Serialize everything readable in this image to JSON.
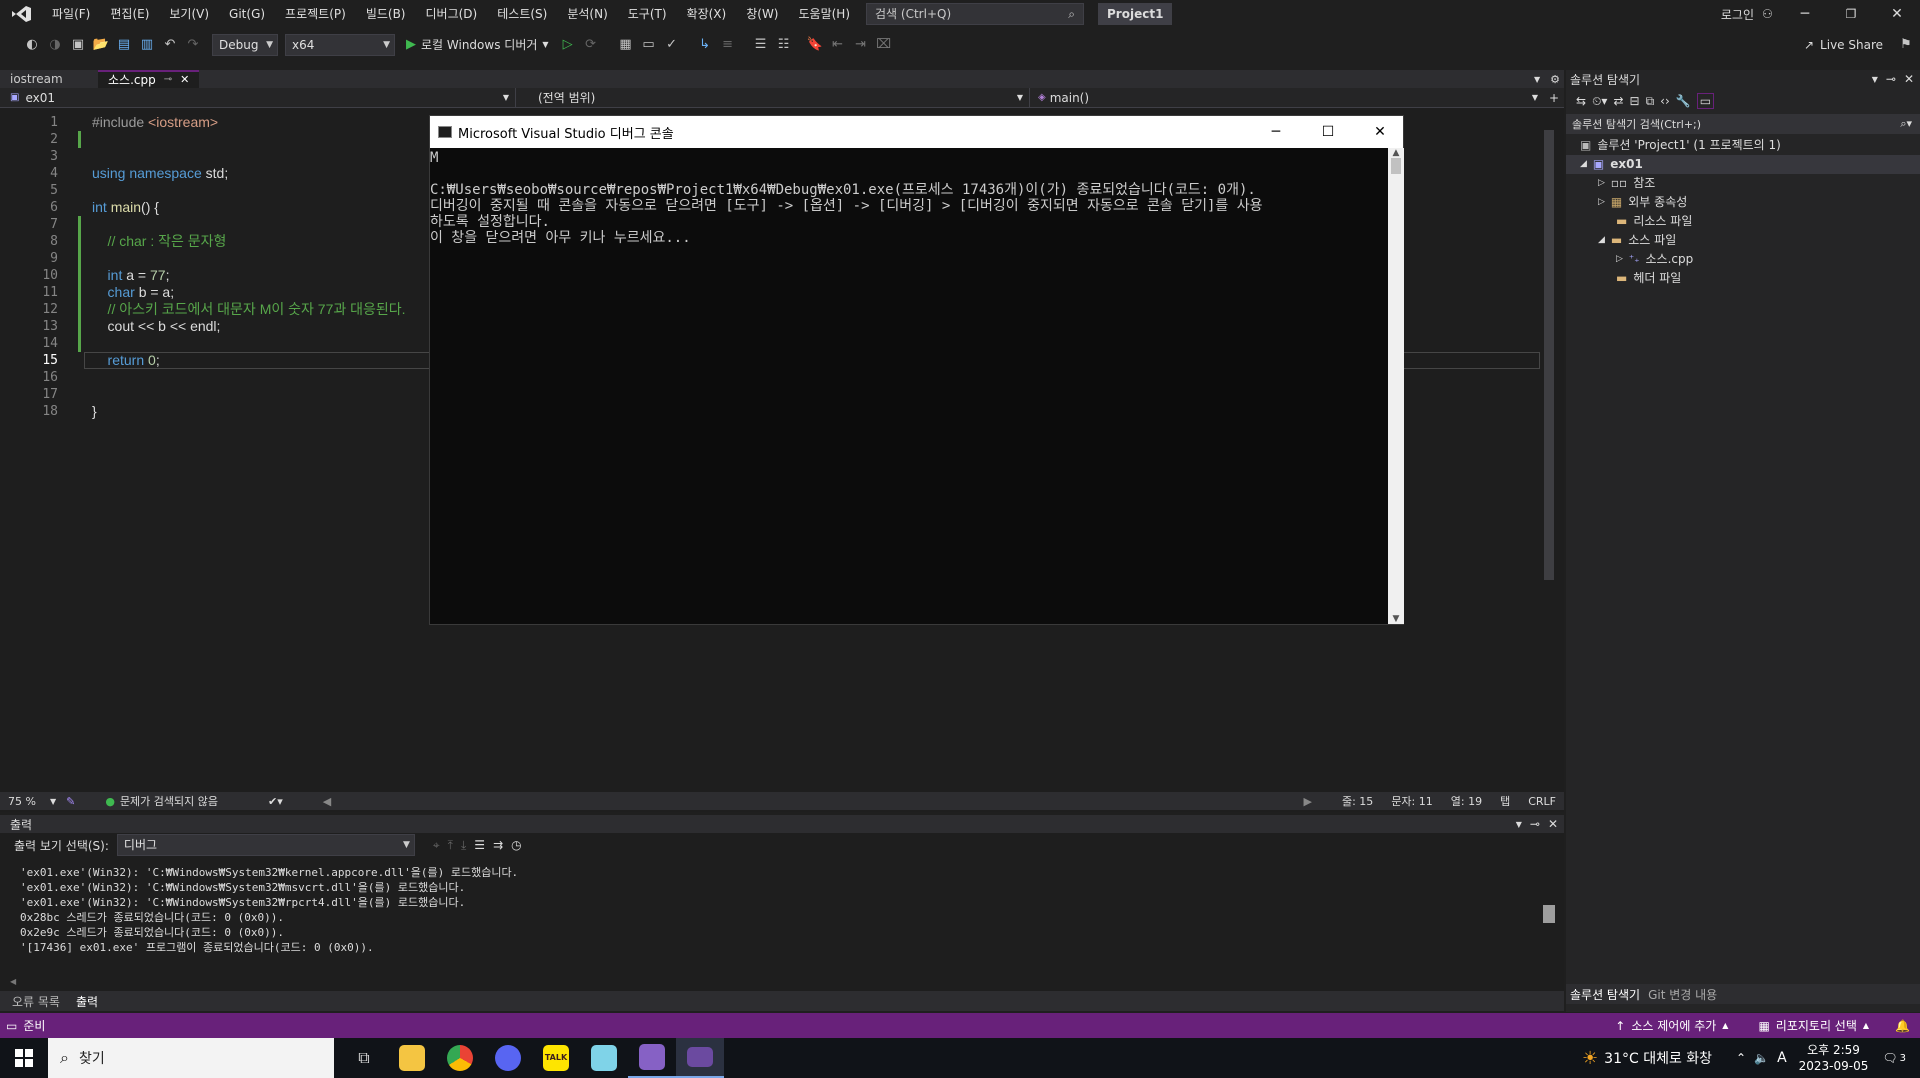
{
  "menu": [
    "파일(F)",
    "편집(E)",
    "보기(V)",
    "Git(G)",
    "프로젝트(P)",
    "빌드(B)",
    "디버그(D)",
    "테스트(S)",
    "분석(N)",
    "도구(T)",
    "확장(X)",
    "창(W)",
    "도움말(H)"
  ],
  "search_placeholder": "검색 (Ctrl+Q)",
  "project_name": "Project1",
  "login": "로그인",
  "live_share": "Live Share",
  "toolbar": {
    "config": "Debug",
    "platform": "x64",
    "run_label": "로컬 Windows 디버거"
  },
  "tabs": [
    "iostream",
    "소스.cpp"
  ],
  "nav": {
    "project": "ex01",
    "scope": "(전역 범위)",
    "member": "main()"
  },
  "code_lines": [
    {
      "n": "1",
      "segments": [
        {
          "c": "pp",
          "t": "#include "
        },
        {
          "c": "str",
          "t": "<iostream>"
        }
      ]
    },
    {
      "n": "2",
      "segments": []
    },
    {
      "n": "3",
      "segments": []
    },
    {
      "n": "4",
      "segments": [
        {
          "c": "kw",
          "t": "using namespace "
        },
        {
          "c": "id",
          "t": "std;"
        }
      ]
    },
    {
      "n": "5",
      "segments": []
    },
    {
      "n": "6",
      "segments": [
        {
          "c": "ty",
          "t": "int "
        },
        {
          "c": "fn",
          "t": "main"
        },
        {
          "c": "id",
          "t": "() {"
        }
      ]
    },
    {
      "n": "7",
      "segments": []
    },
    {
      "n": "8",
      "segments": [
        {
          "c": "cm",
          "t": "    // char : 작은 문자형"
        }
      ]
    },
    {
      "n": "9",
      "segments": []
    },
    {
      "n": "10",
      "segments": [
        {
          "c": "ty",
          "t": "    int "
        },
        {
          "c": "id",
          "t": "a = "
        },
        {
          "c": "num",
          "t": "77"
        },
        {
          "c": "id",
          "t": ";"
        }
      ]
    },
    {
      "n": "11",
      "segments": [
        {
          "c": "ty",
          "t": "    char "
        },
        {
          "c": "id",
          "t": "b = a;"
        }
      ]
    },
    {
      "n": "12",
      "segments": [
        {
          "c": "cm",
          "t": "    // 아스키 코드에서 대문자 M이 숫자 77과 대응된다."
        }
      ]
    },
    {
      "n": "13",
      "segments": [
        {
          "c": "id",
          "t": "    cout << b << endl;"
        }
      ]
    },
    {
      "n": "14",
      "segments": []
    },
    {
      "n": "15",
      "segments": [
        {
          "c": "kw",
          "t": "    return "
        },
        {
          "c": "num",
          "t": "0"
        },
        {
          "c": "id",
          "t": ";"
        }
      ]
    },
    {
      "n": "16",
      "segments": []
    },
    {
      "n": "17",
      "segments": []
    },
    {
      "n": "18",
      "segments": [
        {
          "c": "id",
          "t": "}"
        }
      ]
    }
  ],
  "console": {
    "title": "Microsoft Visual Studio 디버그 콘솔",
    "lines": [
      "M",
      "",
      "C:₩Users₩seobo₩source₩repos₩Project1₩x64₩Debug₩ex01.exe(프로세스 17436개)이(가) 종료되었습니다(코드: 0개).",
      "디버깅이 중지될 때 콘솔을 자동으로 닫으려면 [도구] -> [옵션] -> [디버깅] > [디버깅이 중지되면 자동으로 콘솔 닫기]를 사용",
      "하도록 설정합니다.",
      "이 창을 닫으려면 아무 키나 누르세요..."
    ]
  },
  "editor_status": {
    "zoom": "75 %",
    "issues": "문제가 검색되지 않음",
    "line": "줄: 15",
    "char": "문자: 11",
    "col": "열: 19",
    "tab": "탭",
    "eol": "CRLF"
  },
  "output": {
    "title": "출력",
    "select_label": "출력 보기 선택(S):",
    "select_value": "디버그",
    "lines": [
      "'ex01.exe'(Win32): 'C:₩Windows₩System32₩kernel.appcore.dll'을(를) 로드했습니다.",
      "'ex01.exe'(Win32): 'C:₩Windows₩System32₩msvcrt.dll'을(를) 로드했습니다.",
      "'ex01.exe'(Win32): 'C:₩Windows₩System32₩rpcrt4.dll'을(를) 로드했습니다.",
      "0x28bc 스레드가 종료되었습니다(코드: 0 (0x0)).",
      "0x2e9c 스레드가 종료되었습니다(코드: 0 (0x0)).",
      "'[17436] ex01.exe' 프로그램이 종료되었습니다(코드: 0 (0x0))."
    ],
    "tabs": [
      "오류 목록",
      "출력"
    ]
  },
  "solution": {
    "title": "솔루션 탐색기",
    "search": "솔루션 탐색기 검색(Ctrl+;)",
    "root": "솔루션 'Project1' (1 프로젝트의 1)",
    "project": "ex01",
    "nodes": [
      "참조",
      "외부 종속성",
      "리소스 파일",
      "소스 파일",
      "소스.cpp",
      "헤더 파일"
    ],
    "bottom_tabs": [
      "솔루션 탐색기",
      "Git 변경 내용"
    ]
  },
  "status": {
    "ready": "준비",
    "source_control": "소스 제어에 추가",
    "repo": "리포지토리 선택"
  },
  "taskbar": {
    "search": "찾기",
    "weather": "31°C 대체로 화창",
    "time": "오후 2:59",
    "date": "2023-09-05",
    "ime": "A",
    "notif": "3"
  },
  "colors": {
    "accent": "#68217a",
    "status_bar": "#68217a"
  }
}
